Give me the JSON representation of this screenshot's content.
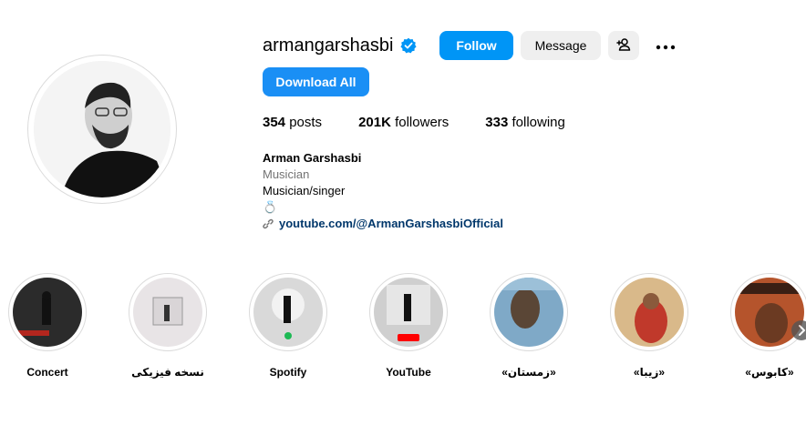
{
  "profile": {
    "username": "armangarshasbi",
    "verified": true,
    "follow_label": "Follow",
    "message_label": "Message",
    "download_label": "Download All",
    "stats": {
      "posts_count": "354",
      "posts_label": "posts",
      "followers_count": "201K",
      "followers_label": "followers",
      "following_count": "333",
      "following_label": "following"
    },
    "bio": {
      "name": "Arman Garshasbi",
      "category": "Musician",
      "line": "Musician/singer",
      "emoji": "💍",
      "link": "youtube.com/@ArmanGarshasbiOfficial"
    }
  },
  "highlights": [
    {
      "label": "Concert"
    },
    {
      "label": "نسخه فیزیکی"
    },
    {
      "label": "Spotify"
    },
    {
      "label": "YouTube"
    },
    {
      "label": "«زمستان»"
    },
    {
      "label": "«زیبا»"
    },
    {
      "label": "«کابوس»"
    }
  ],
  "colors": {
    "primary_button": "#0095f6",
    "secondary_button": "#efefef",
    "link": "#00376b",
    "verified_badge": "#0095f6"
  }
}
